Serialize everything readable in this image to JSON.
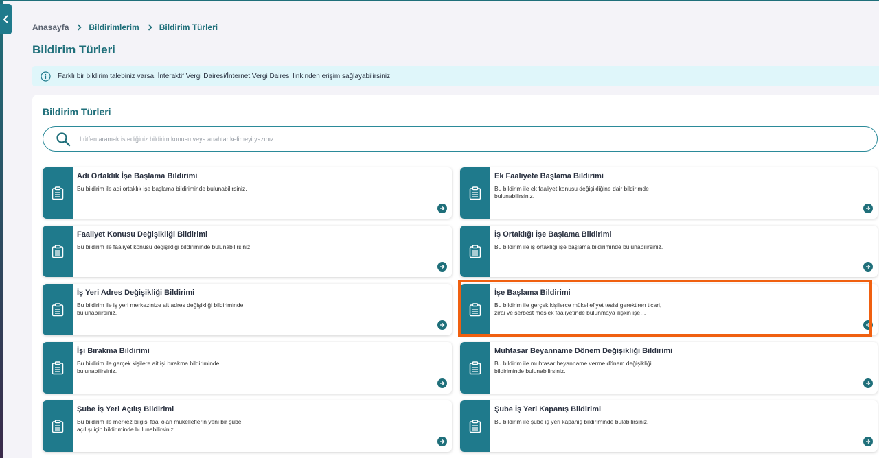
{
  "breadcrumb": {
    "home": "Anasayfa",
    "item1": "Bildirimlerim",
    "item2": "Bildirim Türleri"
  },
  "page_title": "Bildirim Türleri",
  "info": {
    "text": "Farklı bir bildirim talebiniz varsa, İnteraktif Vergi Dairesi/İnternet Vergi Dairesi linkinden erişim sağlayabilirsiniz."
  },
  "panel": {
    "title": "Bildirim Türleri",
    "search_placeholder": "Lütfen aramak istediğiniz bildirim konusu veya anahtar kelimeyi yazınız."
  },
  "cards": [
    {
      "title": "Adi Ortaklık İşe Başlama Bildirimi",
      "desc": "Bu bildirim ile adi ortaklık işe başlama bildiriminde bulunabilirsiniz."
    },
    {
      "title": "Ek Faaliyete Başlama Bildirimi",
      "desc": "Bu bildirim ile ek faaliyet konusu değişikliğine dair bildirimde bulunabilirsiniz."
    },
    {
      "title": "Faaliyet Konusu Değişikliği Bildirimi",
      "desc": "Bu bildirim ile faaliyet konusu değişikliği bildiriminde bulunabilirsiniz."
    },
    {
      "title": "İş Ortaklığı İşe Başlama Bildirimi",
      "desc": "Bu bildirim ile iş ortaklığı işe başlama bildiriminde bulunabilirsiniz."
    },
    {
      "title": "İş Yeri Adres Değişikliği Bildirimi",
      "desc": "Bu bildirim ile iş yeri merkezinize ait adres değişikliği bildiriminde bulunabilirsiniz."
    },
    {
      "title": "İşe Başlama Bildirimi",
      "desc": "Bu bildirim ile gerçek kişilerce mükellefiyet tesisi gerektiren ticari, zirai ve serbest meslek faaliyetinde bulunmaya ilişkin işe…"
    },
    {
      "title": "İşi Bırakma Bildirimi",
      "desc": "Bu bildirim ile gerçek kişilere ait işi bırakma bildiriminde bulunabilirsiniz."
    },
    {
      "title": "Muhtasar Beyanname Dönem Değişikliği Bildirimi",
      "desc": "Bu bildirim ile muhtasar beyanname verme dönem değişikliği bildiriminde bulunabilirsiniz."
    },
    {
      "title": "Şube İş Yeri Açılış Bildirimi",
      "desc": "Bu bildirim ile merkez bilgisi faal olan mükelleflerin yeni bir şube açılışı için bildiriminde bulunabilirsiniz."
    },
    {
      "title": "Şube İş Yeri Kapanış Bildirimi",
      "desc": "Bu bildirim ile şube iş yeri kapanış bildiriminde bulabilirsiniz."
    }
  ],
  "icons": {
    "collapse": "chevron-left-icon",
    "info": "info-icon",
    "search": "search-icon",
    "card": "clipboard-icon",
    "arrow": "arrow-right-circle-icon"
  },
  "colors": {
    "accent": "#1f7a8c",
    "highlight": "#f06010",
    "info_bg": "#dff6fa"
  }
}
